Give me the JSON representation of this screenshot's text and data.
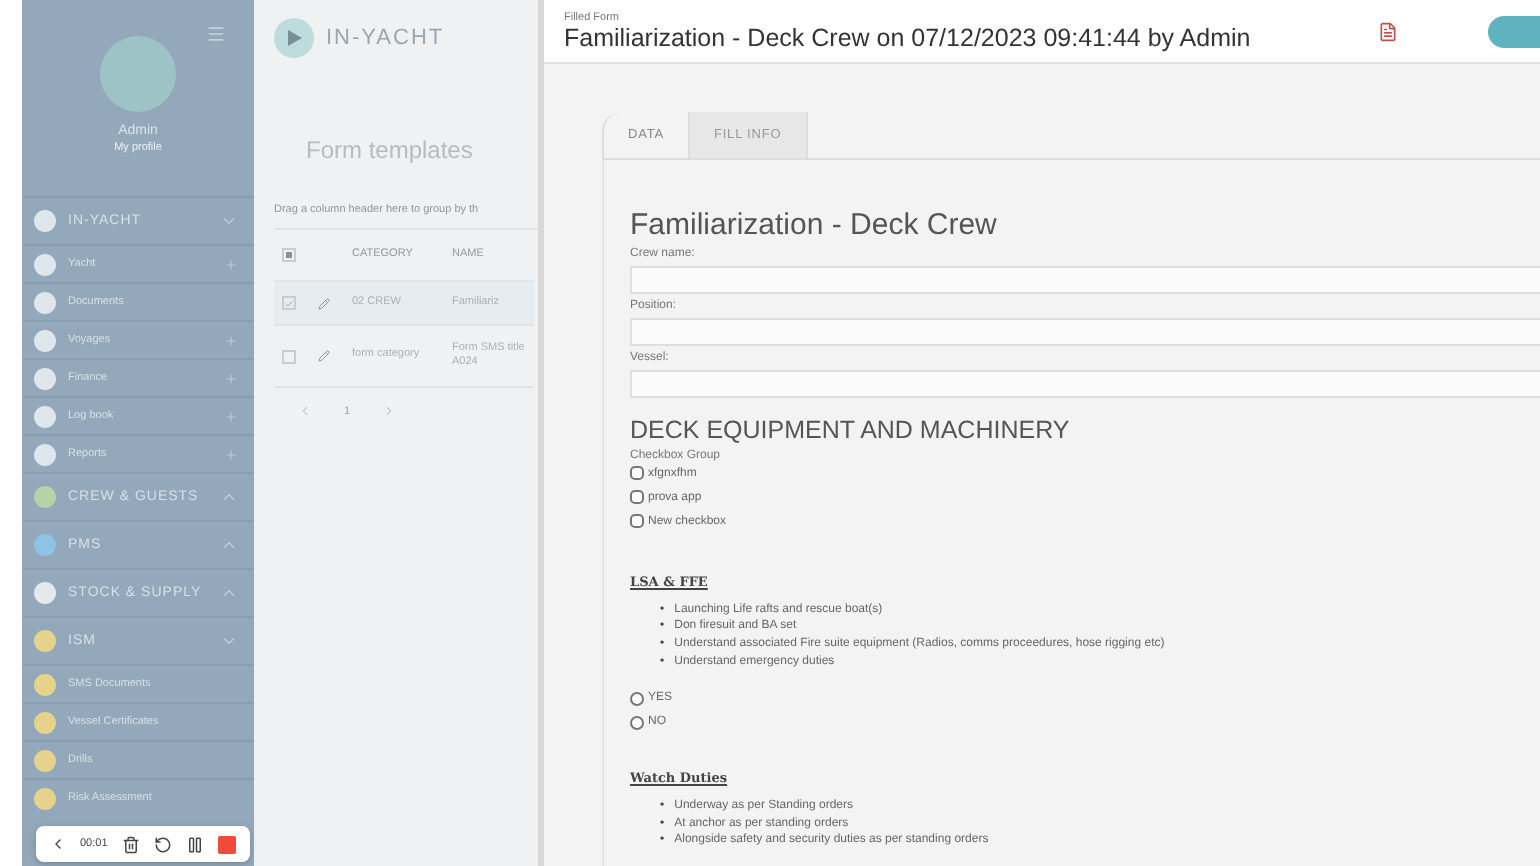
{
  "sidebar": {
    "user": {
      "name": "Admin",
      "link": "My profile"
    },
    "items": [
      {
        "kind": "section",
        "label": "IN-YACHT",
        "color": "#dfe6ec",
        "expanded": true
      },
      {
        "kind": "item",
        "label": "Yacht",
        "color": "#dfe6ec",
        "expandable": true
      },
      {
        "kind": "item",
        "label": "Documents",
        "color": "#dfe6ec",
        "expandable": false
      },
      {
        "kind": "item",
        "label": "Voyages",
        "color": "#dfe6ec",
        "expandable": true
      },
      {
        "kind": "item",
        "label": "Finance",
        "color": "#dfe6ec",
        "expandable": true
      },
      {
        "kind": "item",
        "label": "Log book",
        "color": "#dfe6ec",
        "expandable": true
      },
      {
        "kind": "item",
        "label": "Reports",
        "color": "#dfe6ec",
        "expandable": true
      },
      {
        "kind": "section",
        "label": "CREW & GUESTS",
        "color": "#b5d3a8",
        "expanded": false
      },
      {
        "kind": "section",
        "label": "PMS",
        "color": "#8fc3e6",
        "expanded": false
      },
      {
        "kind": "section",
        "label": "STOCK & SUPPLY",
        "color": "#e6e9ec",
        "expanded": false
      },
      {
        "kind": "section",
        "label": "ISM",
        "color": "#e6d28a",
        "expanded": true
      },
      {
        "kind": "item",
        "label": "SMS Documents",
        "color": "#e6d28a",
        "expandable": false
      },
      {
        "kind": "item",
        "label": "Vessel Certificates",
        "color": "#e6d28a",
        "expandable": false
      },
      {
        "kind": "item",
        "label": "Drills",
        "color": "#e6d28a",
        "expandable": false
      },
      {
        "kind": "item",
        "label": "Risk Assessment",
        "color": "#e6d28a",
        "expandable": false
      }
    ]
  },
  "background_page": {
    "logo": "IN-YACHT",
    "title": "Form templates",
    "group_hint": "Drag a column header here to group by th",
    "table": {
      "select_all_partial": true,
      "columns": [
        "CATEGORY",
        "NAME"
      ],
      "rows": [
        {
          "selected": true,
          "cells": [
            "02 CREW",
            "Familiariz"
          ]
        },
        {
          "selected": false,
          "cells": [
            "form category",
            "Form SMS title A024"
          ]
        }
      ]
    },
    "pages": [
      {
        "label": "1",
        "selected": true
      }
    ]
  },
  "recorder": {
    "time": "00:01"
  },
  "panel": {
    "caption": "Filled Form",
    "title": "Familiarization - Deck Crew on 07/12/2023 09:41:44 by Admin",
    "tabs": [
      {
        "label": "DATA",
        "selected": true
      },
      {
        "label": "FILL INFO",
        "selected": false
      }
    ],
    "form": {
      "title": "Familiarization - Deck Crew",
      "fields": [
        {
          "label": "Crew name:"
        },
        {
          "label": "Position:"
        },
        {
          "label": "Vessel:"
        }
      ],
      "section": "DECK EQUIPMENT AND MACHINERY",
      "checkbox_group": {
        "label": "Checkbox Group",
        "options": [
          {
            "label": "xfgnxfhm",
            "checked": false
          },
          {
            "label": "prova app",
            "checked": false
          },
          {
            "label": "New checkbox",
            "checked": false
          }
        ]
      },
      "blocks": [
        {
          "heading": "LSA & FFE",
          "marker": "•",
          "bullets": [
            "Launching Life rafts and rescue boat(s)",
            "Don firesuit and BA set",
            "Understand associated Fire suite equipment (Radios, comms proceedures, hose rigging etc)",
            "Understand emergency duties"
          ],
          "options": [
            {
              "label": "YES",
              "selected": false
            },
            {
              "label": "NO",
              "selected": false
            }
          ]
        },
        {
          "heading": "Watch Duties",
          "marker": "•",
          "bullets": [
            "Underway as per Standing orders",
            "At anchor as per standing orders",
            "Alongside safety and security duties as per standing orders"
          ]
        }
      ]
    }
  }
}
